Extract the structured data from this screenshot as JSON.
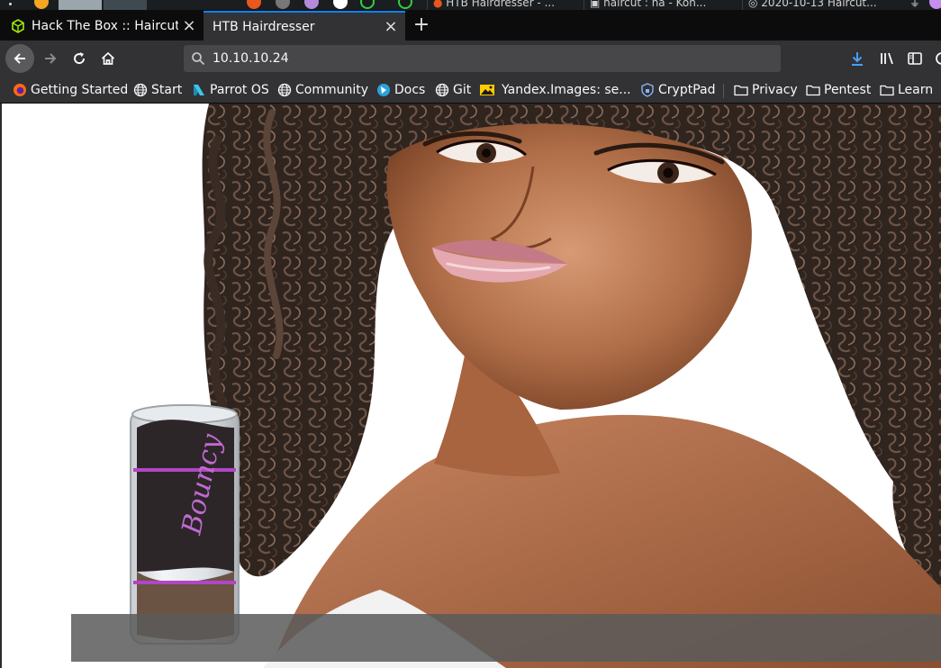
{
  "taskbar": {
    "tabs": [
      {
        "label": "HTB Hairdresser - ..."
      },
      {
        "label": "haircut : na - Kon..."
      },
      {
        "label": "2020-10-13 Haircut..."
      }
    ]
  },
  "tabs": [
    {
      "title": "Hack The Box :: Haircut",
      "active": false
    },
    {
      "title": "HTB Hairdresser",
      "active": true
    }
  ],
  "newtab_label": "+",
  "close_glyph": "×",
  "url": "10.10.10.24",
  "bookmarks": [
    {
      "label": "Getting Started",
      "icon": "firefox-icon"
    },
    {
      "label": "Start",
      "icon": "globe-icon"
    },
    {
      "label": "Parrot OS",
      "icon": "parrot-icon"
    },
    {
      "label": "Community",
      "icon": "globe-icon"
    },
    {
      "label": "Docs",
      "icon": "docs-icon"
    },
    {
      "label": "Git",
      "icon": "globe-icon"
    },
    {
      "label": "Yandex.Images: se...",
      "icon": "yandex-images-icon"
    },
    {
      "label": "CryptPad",
      "icon": "cryptpad-icon"
    },
    {
      "label": "Privacy",
      "icon": "folder-icon"
    },
    {
      "label": "Pentest",
      "icon": "folder-icon"
    },
    {
      "label": "Learn",
      "icon": "folder-icon"
    }
  ],
  "product_label": "Bouncy",
  "colors": {
    "tab_accent": "#0a84ff",
    "toolbar_bg": "#323234",
    "download_blue": "#45a1ff"
  }
}
